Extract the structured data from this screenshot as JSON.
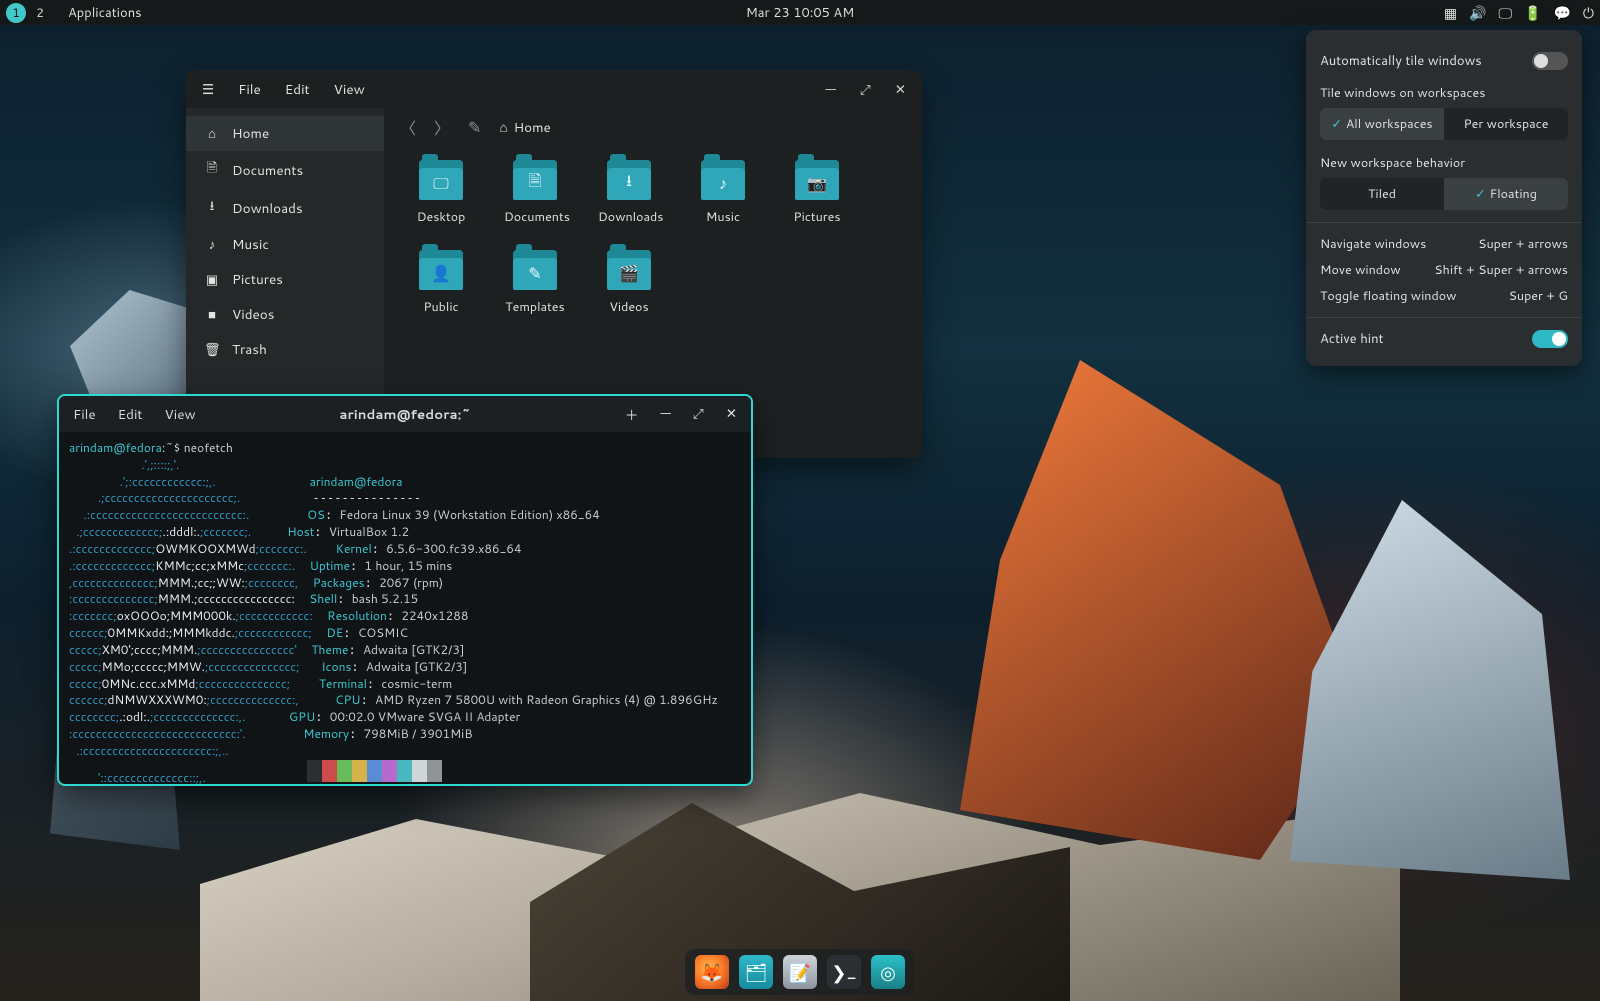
{
  "panel": {
    "workspaces": [
      "1",
      "2"
    ],
    "apps_label": "Applications",
    "clock": "Mar 23 10:05 AM"
  },
  "popover": {
    "auto_tile": "Automatically tile windows",
    "tile_head": "Tile windows on workspaces",
    "seg1_a": "All workspaces",
    "seg1_b": "Per workspace",
    "nw_head": "New workspace behavior",
    "seg2_a": "Tiled",
    "seg2_b": "Floating",
    "kb": [
      {
        "l": "Navigate windows",
        "r": "Super + arrows"
      },
      {
        "l": "Move window",
        "r": "Shift + Super + arrows"
      },
      {
        "l": "Toggle floating window",
        "r": "Super + G"
      }
    ],
    "hint": "Active hint"
  },
  "files": {
    "menus": [
      "File",
      "Edit",
      "View"
    ],
    "side": [
      {
        "ic": "⌂",
        "t": "Home"
      },
      {
        "ic": "🗎",
        "t": "Documents"
      },
      {
        "ic": "⭳",
        "t": "Downloads"
      },
      {
        "ic": "♪",
        "t": "Music"
      },
      {
        "ic": "▣",
        "t": "Pictures"
      },
      {
        "ic": "■",
        "t": "Videos"
      },
      {
        "ic": "🗑",
        "t": "Trash"
      }
    ],
    "crumb": "Home",
    "grid": [
      {
        "g": "🖵",
        "t": "Desktop"
      },
      {
        "g": "🗎",
        "t": "Documents"
      },
      {
        "g": "⭳",
        "t": "Downloads"
      },
      {
        "g": "♪",
        "t": "Music"
      },
      {
        "g": "📷",
        "t": "Pictures"
      },
      {
        "g": "👤",
        "t": "Public"
      },
      {
        "g": "✎",
        "t": "Templates"
      },
      {
        "g": "🎬",
        "t": "Videos"
      }
    ]
  },
  "term": {
    "menus": [
      "File",
      "Edit",
      "View"
    ],
    "title": "arindam@fedora:~",
    "prompt_user": "arindam@fedora",
    "prompt_path": ":~$ ",
    "cmd": "neofetch",
    "fetch_user": "arindam@fedora",
    "rows": [
      {
        "k": "OS",
        "v": "Fedora Linux 39 (Workstation Edition) x86_64"
      },
      {
        "k": "Host",
        "v": "VirtualBox 1.2"
      },
      {
        "k": "Kernel",
        "v": "6.5.6-300.fc39.x86_64"
      },
      {
        "k": "Uptime",
        "v": "1 hour, 15 mins"
      },
      {
        "k": "Packages",
        "v": "2067 (rpm)"
      },
      {
        "k": "Shell",
        "v": "bash 5.2.15"
      },
      {
        "k": "Resolution",
        "v": "2240x1288"
      },
      {
        "k": "DE",
        "v": "COSMIC"
      },
      {
        "k": "Theme",
        "v": "Adwaita [GTK2/3]"
      },
      {
        "k": "Icons",
        "v": "Adwaita [GTK2/3]"
      },
      {
        "k": "Terminal",
        "v": "cosmic-term"
      },
      {
        "k": "CPU",
        "v": "AMD Ryzen 7 5800U with Radeon Graphics (4) @ 1.896GHz"
      },
      {
        "k": "GPU",
        "v": "00:02.0 VMware SVGA II Adapter"
      },
      {
        "k": "Memory",
        "v": "798MiB / 3901MiB"
      }
    ],
    "swatches": [
      "#2b2f33",
      "#cc4b4b",
      "#6abb5a",
      "#d6b24a",
      "#5a8cd6",
      "#b66bcc",
      "#46b8c0",
      "#d0d5d9",
      "#8f9497"
    ],
    "ascii": [
      {
        "pre": "          ",
        "c": ".',;::::;,'."
      },
      {
        "pre": "       ",
        "c": ".';:cccccccccccc:;,."
      },
      {
        "pre": "    ",
        "c": ".;cccccccccccccccccccccc;."
      },
      {
        "pre": "  ",
        "c": ".:cccccccccccccccccccccccccc:."
      },
      {
        "pre": " ",
        "c": ".;ccccccccccccc;",
        "w": ".:dddl:.",
        "c2": ";ccccccc;."
      },
      {
        "pre": "",
        "c": ".:ccccccccccccc;",
        "w": "OWMKOOXMWd",
        "c2": ";ccccccc:."
      },
      {
        "pre": "",
        "c": ".:ccccccccccccc;",
        "w": "KMMc;cc;xMMc",
        "c2": ";ccccccc:."
      },
      {
        "pre": "",
        "c": ",cccccccccccccc;",
        "w": "MMM.;cc;;WW:",
        "c2": ";cccccccc,"
      },
      {
        "pre": "",
        "c": ":cccccccccccccc;",
        "w": "MMM.;cccccccccccccccc:"
      },
      {
        "pre": "",
        "c": ":ccccccc;",
        "w": "oxOOOo;MMM000k.",
        "c2": ";cccccccccccc:"
      },
      {
        "pre": "",
        "c": "cccccc;",
        "w": "0MMKxdd:;MMMkddc.",
        "c2": ";cccccccccccc;"
      },
      {
        "pre": "",
        "c": "ccccc;",
        "w": "XM0';cccc;MMM.",
        "c2": ";cccccccccccccccc'"
      },
      {
        "pre": "",
        "c": "ccccc;",
        "w": "MMo;ccccc;MMW.",
        "c2": ";ccccccccccccccc;"
      },
      {
        "pre": "",
        "c": "ccccc;",
        "w": "0MNc.ccc.xMMd",
        "c2": ";ccccccccccccccc;"
      },
      {
        "pre": "",
        "c": "cccccc;",
        "w": "dNMWXXXWM0:",
        "c2": ";cccccccccccccc:,"
      },
      {
        "pre": "",
        "c": "cccccccc;",
        "w": ".:odl:.",
        "c2": ";cccccccccccccc:,."
      },
      {
        "pre": "",
        "c": ":cccccccccccccccccccccccccccc:'."
      },
      {
        "pre": " ",
        "c": ".:cccccccccccccccccccccc:;,.."
      },
      {
        "pre": "    ",
        "c": "'::cccccccccccccc::;,."
      }
    ]
  },
  "dock": {
    "apps": [
      "firefox",
      "filesapp",
      "editor",
      "termapp",
      "cosmic"
    ]
  }
}
